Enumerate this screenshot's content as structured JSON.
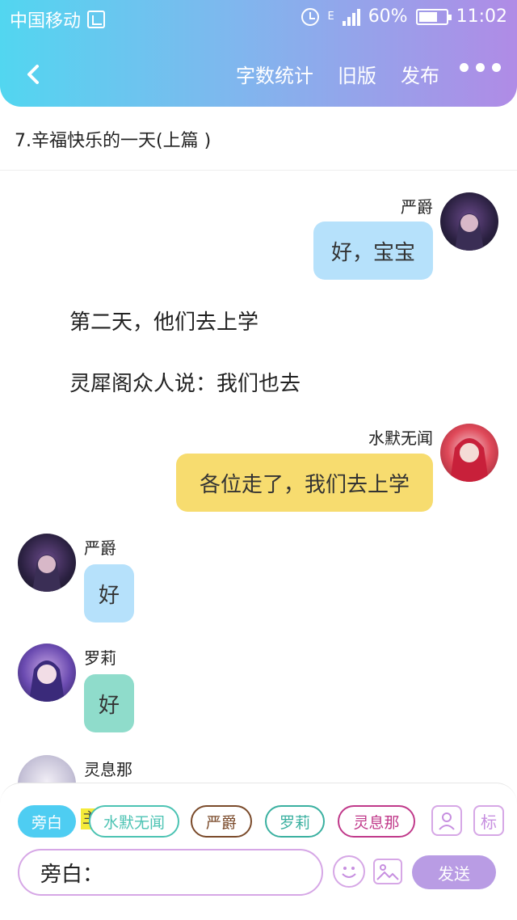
{
  "status_bar": {
    "carrier": "中国移动",
    "network_type": "E",
    "battery": "60%",
    "time": "11:02"
  },
  "toolbar": {
    "word_count": "字数统计",
    "old_version": "旧版",
    "publish": "发布"
  },
  "story_title": "7.辛福快乐的一天(上篇 )",
  "messages": [
    {
      "type": "right",
      "name": "严爵",
      "text": "好，宝宝",
      "bubble_color": "#b6e1fb"
    },
    {
      "type": "narration",
      "text": "第二天，他们去上学"
    },
    {
      "type": "narration",
      "text": "灵犀阁众人说：我们也去"
    },
    {
      "type": "right",
      "name": "水默无闻",
      "text": "各位走了，我们去上学",
      "bubble_color": "#f7dc6f"
    },
    {
      "type": "left",
      "name": "严爵",
      "text": "好",
      "bubble_color": "#b6e1fb"
    },
    {
      "type": "left",
      "name": "罗莉",
      "text": "好",
      "bubble_color": "#8fdccb"
    },
    {
      "type": "left",
      "name": "灵息那",
      "text": ""
    }
  ],
  "characters": [
    {
      "label": "旁白",
      "color": "#4ecdf2"
    },
    {
      "label": "水默无闻",
      "color": "#4cc3b3"
    },
    {
      "label": "严爵",
      "color": "#7a4a2a"
    },
    {
      "label": "罗莉",
      "color": "#3ab0a0"
    },
    {
      "label": "灵息那",
      "color": "#c0398a"
    }
  ],
  "main_marker": "主",
  "tag_icon_label": "标",
  "input": {
    "value": "旁白："
  },
  "send_label": "发送",
  "colors": {
    "accent": "#b99ce4",
    "gradient_start": "#52d6f0",
    "gradient_end": "#b08be6"
  }
}
